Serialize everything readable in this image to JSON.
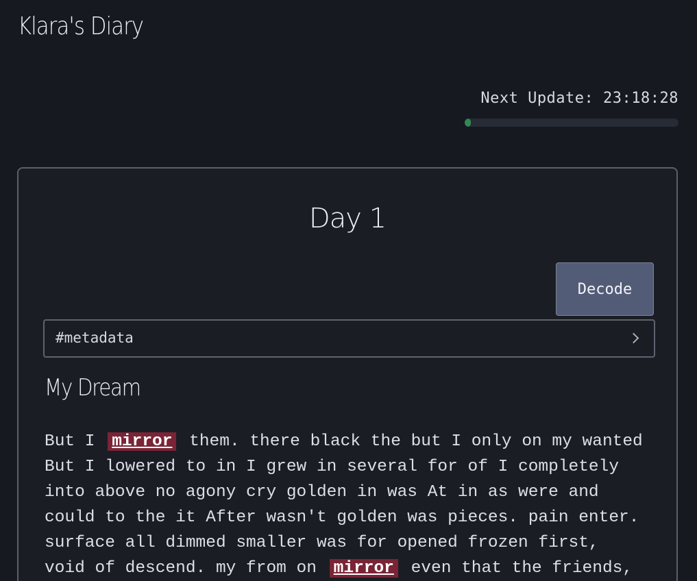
{
  "site": {
    "title": "Klara's Diary"
  },
  "update": {
    "label": "Next Update: 23:18:28",
    "progress": 0.03
  },
  "entry": {
    "day": "Day 1",
    "decode_label": "Decode",
    "metadata_label": "#metadata",
    "title": "My Dream",
    "line1": {
      "before": "But I",
      "keyword": "mirror",
      "after": "them. there black the but I only on my wanted"
    },
    "line2": "But I lowered to in I grew in several for of I completely",
    "line3": "into above no agony cry golden in was At in as were and",
    "line4": "could to the it After wasn't golden was pieces. pain enter.",
    "line5": "surface all dimmed smaller was for opened frozen first,",
    "line6": {
      "before": "void of descend. my from on",
      "keyword": "mirror",
      "after": "even that the friends,"
    }
  },
  "colors": {
    "background": "#161920",
    "card": "#1b1d25",
    "button": "#525c77",
    "progress": "#2f8a56",
    "highlight": "#7a2436"
  }
}
